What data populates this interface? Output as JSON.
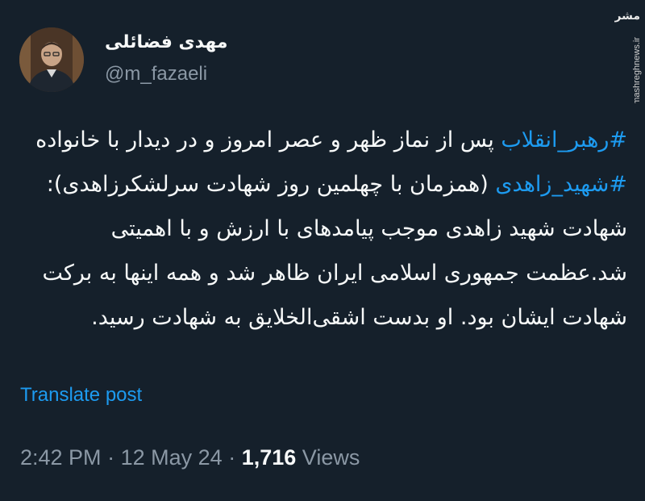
{
  "author": {
    "display_name": "مهدی فضائلی",
    "handle": "@m_fazaeli"
  },
  "watermark": {
    "logo_text": "مشرق",
    "url": "mashreghnews.ir"
  },
  "tweet": {
    "hashtag1": "#رهبر_انقلاب",
    "text1": " پس از نماز ظهر و عصر امروز و در دیدار با خانواده ",
    "hashtag2": "#شهید_زاهدی",
    "text2": " (همزمان با چهلمین روز شهادت سرلشکرزاهدی): شهادت شهید زاهدی موجب پیامدهای با ارزش و با اهمیتی شد.عظمت جمهوری اسلامی ایران ظاهر شد و همه اینها به برکت شهادت ایشان بود. او بدست اشقی‌الخلایق به شهادت رسید.",
    "translate_label": "Translate post",
    "time": "2:42 PM",
    "separator": "·",
    "date": "12 May 24",
    "views_count": "1,716",
    "views_label": "Views"
  },
  "colors": {
    "background": "#15202b",
    "link": "#1d9bf0",
    "secondary_text": "#8b98a5",
    "primary_text": "#f7f9f9"
  }
}
